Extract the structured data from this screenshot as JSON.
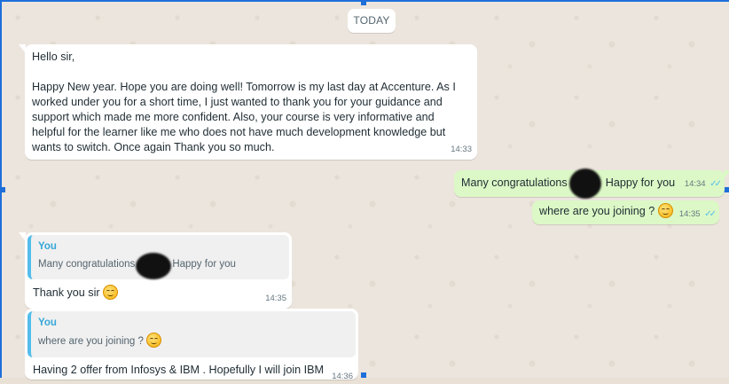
{
  "chat": {
    "day_label": "TODAY",
    "messages": [
      {
        "text": "Hello sir,\n\nHappy New year. Hope you are doing well! Tomorrow is my last day at Accenture. As I worked under you for a short time, I just wanted to thank you for your guidance and support which made me more confident. Also, your course is very informative and helpful for the learner like me who does not have much development knowledge but wants to switch. Once again Thank you so much.",
        "time": "14:33"
      },
      {
        "text_before": "Many congratulations",
        "text_after": "Happy for you",
        "time": "14:34",
        "ticks": "✓✓"
      },
      {
        "text": "where are you joining ?",
        "time": "14:35",
        "ticks": "✓✓"
      },
      {
        "quote_author": "You",
        "quote_before": "Many congratulations",
        "quote_after": "Happy for you",
        "text": "Thank you sir",
        "time": "14:35"
      },
      {
        "quote_author": "You",
        "quote_text": "where are you joining ?",
        "text": "Having 2 offer from Infosys & IBM . Hopefully I will join IBM",
        "time": "14:36"
      }
    ]
  }
}
